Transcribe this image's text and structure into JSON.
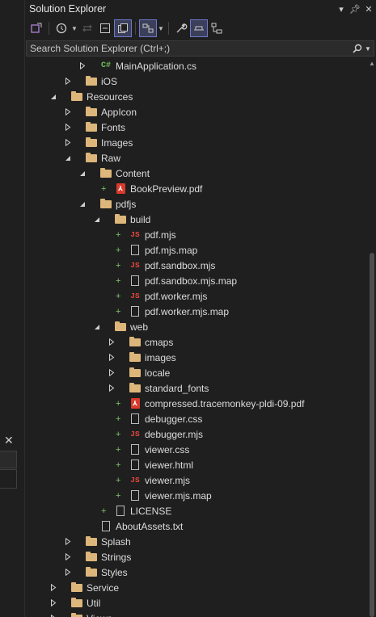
{
  "window": {
    "title": "Solution Explorer"
  },
  "search": {
    "placeholder": "Search Solution Explorer (Ctrl+;)"
  },
  "tree": [
    {
      "label": "MainApplication.cs",
      "depth": 2,
      "expander": "collapsed",
      "icon": "csharp-file-icon",
      "type": "cs"
    },
    {
      "label": "iOS",
      "depth": 1,
      "expander": "collapsed",
      "icon": "folder-icon",
      "type": "folder"
    },
    {
      "label": "Resources",
      "depth": 0,
      "expander": "expanded",
      "icon": "folder-icon",
      "type": "folder"
    },
    {
      "label": "AppIcon",
      "depth": 1,
      "expander": "collapsed",
      "icon": "folder-icon",
      "type": "folder"
    },
    {
      "label": "Fonts",
      "depth": 1,
      "expander": "collapsed",
      "icon": "folder-icon",
      "type": "folder"
    },
    {
      "label": "Images",
      "depth": 1,
      "expander": "collapsed",
      "icon": "folder-icon",
      "type": "folder"
    },
    {
      "label": "Raw",
      "depth": 1,
      "expander": "expanded",
      "icon": "folder-icon",
      "type": "folder"
    },
    {
      "label": "Content",
      "depth": 2,
      "expander": "expanded",
      "icon": "folder-icon",
      "type": "folder"
    },
    {
      "label": "BookPreview.pdf",
      "depth": 3,
      "expander": "none",
      "plus": true,
      "icon": "pdf-file-icon",
      "type": "pdf"
    },
    {
      "label": "pdfjs",
      "depth": 2,
      "expander": "expanded",
      "icon": "folder-icon",
      "type": "folder"
    },
    {
      "label": "build",
      "depth": 3,
      "expander": "expanded",
      "icon": "folder-icon",
      "type": "folder"
    },
    {
      "label": "pdf.mjs",
      "depth": 4,
      "expander": "none",
      "plus": true,
      "icon": "js-file-icon",
      "type": "js"
    },
    {
      "label": "pdf.mjs.map",
      "depth": 4,
      "expander": "none",
      "plus": true,
      "icon": "map-file-icon",
      "type": "doc"
    },
    {
      "label": "pdf.sandbox.mjs",
      "depth": 4,
      "expander": "none",
      "plus": true,
      "icon": "js-file-icon",
      "type": "js"
    },
    {
      "label": "pdf.sandbox.mjs.map",
      "depth": 4,
      "expander": "none",
      "plus": true,
      "icon": "map-file-icon",
      "type": "doc"
    },
    {
      "label": "pdf.worker.mjs",
      "depth": 4,
      "expander": "none",
      "plus": true,
      "icon": "js-file-icon",
      "type": "js"
    },
    {
      "label": "pdf.worker.mjs.map",
      "depth": 4,
      "expander": "none",
      "plus": true,
      "icon": "map-file-icon",
      "type": "doc"
    },
    {
      "label": "web",
      "depth": 3,
      "expander": "expanded",
      "icon": "folder-icon",
      "type": "folder"
    },
    {
      "label": "cmaps",
      "depth": 4,
      "expander": "collapsed",
      "icon": "folder-icon",
      "type": "folder"
    },
    {
      "label": "images",
      "depth": 4,
      "expander": "collapsed",
      "icon": "folder-icon",
      "type": "folder"
    },
    {
      "label": "locale",
      "depth": 4,
      "expander": "collapsed",
      "icon": "folder-icon",
      "type": "folder"
    },
    {
      "label": "standard_fonts",
      "depth": 4,
      "expander": "collapsed",
      "icon": "folder-icon",
      "type": "folder"
    },
    {
      "label": "compressed.tracemonkey-pldi-09.pdf",
      "depth": 4,
      "expander": "none",
      "plus": true,
      "icon": "pdf-file-icon",
      "type": "pdf"
    },
    {
      "label": "debugger.css",
      "depth": 4,
      "expander": "none",
      "plus": true,
      "icon": "css-file-icon",
      "type": "doc"
    },
    {
      "label": "debugger.mjs",
      "depth": 4,
      "expander": "none",
      "plus": true,
      "icon": "js-file-icon",
      "type": "js"
    },
    {
      "label": "viewer.css",
      "depth": 4,
      "expander": "none",
      "plus": true,
      "icon": "css-file-icon",
      "type": "doc"
    },
    {
      "label": "viewer.html",
      "depth": 4,
      "expander": "none",
      "plus": true,
      "icon": "html-file-icon",
      "type": "doc"
    },
    {
      "label": "viewer.mjs",
      "depth": 4,
      "expander": "none",
      "plus": true,
      "icon": "js-file-icon",
      "type": "js"
    },
    {
      "label": "viewer.mjs.map",
      "depth": 4,
      "expander": "none",
      "plus": true,
      "icon": "map-file-icon",
      "type": "doc"
    },
    {
      "label": "LICENSE",
      "depth": 3,
      "expander": "none",
      "plus": true,
      "icon": "text-file-icon",
      "type": "doc"
    },
    {
      "label": "AboutAssets.txt",
      "depth": 2,
      "expander": "none",
      "icon": "text-file-icon",
      "type": "doc"
    },
    {
      "label": "Splash",
      "depth": 1,
      "expander": "collapsed",
      "icon": "folder-icon",
      "type": "folder"
    },
    {
      "label": "Strings",
      "depth": 1,
      "expander": "collapsed",
      "icon": "folder-icon",
      "type": "folder"
    },
    {
      "label": "Styles",
      "depth": 1,
      "expander": "collapsed",
      "icon": "folder-icon",
      "type": "folder"
    },
    {
      "label": "Service",
      "depth": 0,
      "expander": "collapsed",
      "icon": "folder-icon",
      "type": "folder"
    },
    {
      "label": "Util",
      "depth": 0,
      "expander": "collapsed",
      "icon": "folder-icon",
      "type": "folder"
    },
    {
      "label": "Views",
      "depth": 0,
      "expander": "collapsed",
      "icon": "folder-icon",
      "type": "folder"
    }
  ]
}
